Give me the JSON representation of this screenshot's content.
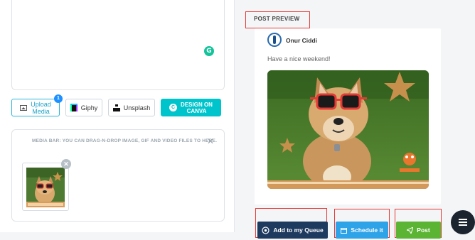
{
  "composer": {
    "grammarly_icon": "grammarly-icon",
    "tools": {
      "upload_label_line1": "Upload",
      "upload_label_line2": "Media",
      "upload_badge": "1",
      "giphy_label": "Giphy",
      "unsplash_label": "Unsplash",
      "canva_label_line1": "DESIGN ON",
      "canva_label_line2": "CANVA",
      "canva_color": "#00c4cc"
    },
    "media_bar": {
      "hint": "MEDIA BAR: YOU CAN DRAG-N-DROP IMAGE, GIF AND VIDEO FILES TO HERE.",
      "close_icon": "✕",
      "thumb_remove": "✕"
    }
  },
  "preview": {
    "title": "POST PREVIEW",
    "author": "Onur Ciddi",
    "text": "Have a nice weekend!",
    "image_alt": "dog with sunglasses"
  },
  "actions": {
    "queue_label": "Add to my Queue",
    "schedule_label": "Schedule it",
    "post_label": "Post",
    "queue_color": "#1e3a5f",
    "schedule_color": "#2ea3e8",
    "post_color": "#5bb434",
    "highlight_color": "#e53935"
  },
  "fab": {
    "icon": "menu-icon"
  }
}
